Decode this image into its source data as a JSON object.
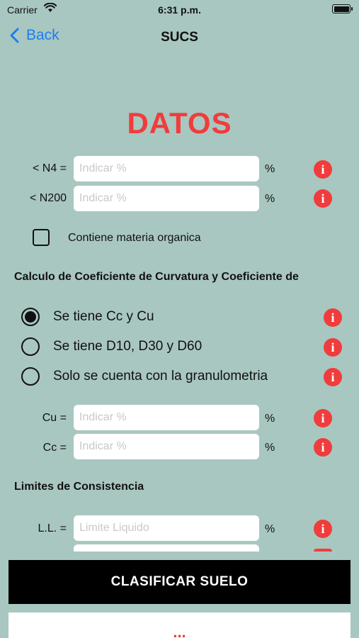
{
  "status": {
    "carrier": "Carrier",
    "time": "6:31 p.m."
  },
  "nav": {
    "back_label": "Back",
    "title": "SUCS"
  },
  "heading": "DATOS",
  "rows_top": [
    {
      "label": "< N4 =",
      "placeholder": "Indicar %",
      "unit": "%"
    },
    {
      "label": "< N200",
      "placeholder": "Indicar %",
      "unit": "%"
    }
  ],
  "organic": {
    "label": "Contiene materia organica",
    "checked": false
  },
  "section_curvature": "Calculo de Coeficiente de Curvatura y Coeficiente de",
  "radios": [
    {
      "label": "Se tiene Cc y Cu",
      "selected": true
    },
    {
      "label": "Se tiene D10, D30 y D60",
      "selected": false
    },
    {
      "label": "Solo se cuenta con la granulometria",
      "selected": false
    }
  ],
  "rows_coef": [
    {
      "label": "Cu =",
      "placeholder": "Indicar %",
      "unit": "%"
    },
    {
      "label": "Cc =",
      "placeholder": "Indicar %",
      "unit": "%"
    }
  ],
  "section_limits": "Limites de Consistencia",
  "rows_limits": [
    {
      "label": "L.L. =",
      "placeholder": "Limite Liquido",
      "unit": "%"
    }
  ],
  "buttons": {
    "classify": "CLASIFICAR SUELO",
    "more": "..."
  },
  "icons": {
    "info": "i"
  },
  "colors": {
    "accent_red": "#f03c3c",
    "background": "#a8c7c0",
    "link_blue": "#1a7ef5"
  }
}
